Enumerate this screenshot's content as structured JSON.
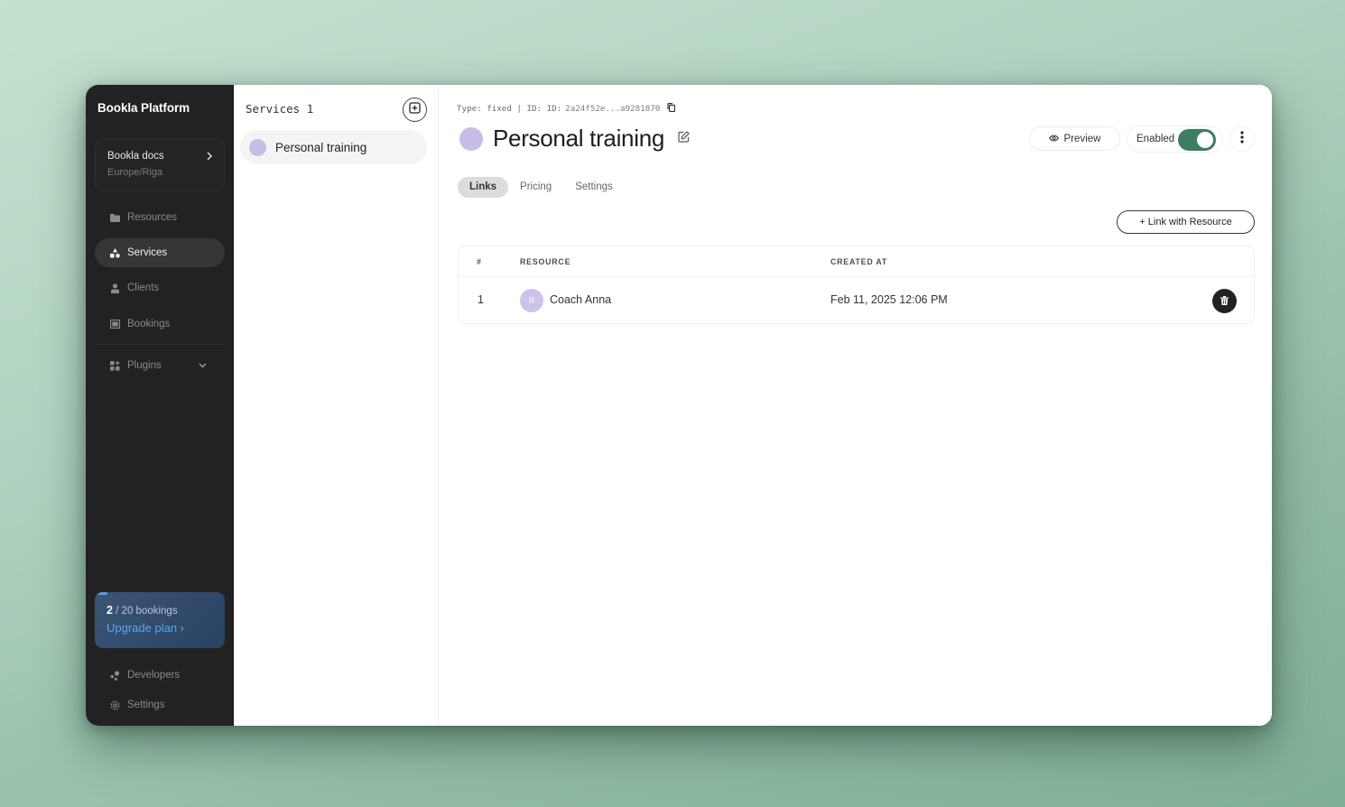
{
  "app": {
    "brand": "Bookla Platform"
  },
  "sidebar": {
    "org": {
      "name": "Bookla docs",
      "timezone": "Europe/Riga",
      "chevron": "chevron-right-icon"
    },
    "items": [
      {
        "label": "Resources",
        "icon": "folder-icon",
        "active": false
      },
      {
        "label": "Services",
        "icon": "shapes-icon",
        "active": true
      },
      {
        "label": "Clients",
        "icon": "user-icon",
        "active": false
      },
      {
        "label": "Bookings",
        "icon": "calendar-icon",
        "active": false
      },
      {
        "label": "Plugins",
        "icon": "grid-icon",
        "active": false,
        "expandable": true
      }
    ],
    "plan": {
      "used": "2",
      "separator": " / ",
      "total_label": "20 bookings",
      "progress": 0.1,
      "upgrade_label": "Upgrade plan ›"
    },
    "bottom_items": [
      {
        "label": "Developers",
        "icon": "developers-icon"
      },
      {
        "label": "Settings",
        "icon": "gear-icon"
      }
    ]
  },
  "services_pane": {
    "title": "Services 1",
    "add_icon": "add-square-icon",
    "items": [
      {
        "label": "Personal training",
        "color": "#c9bce6",
        "selected": true
      }
    ]
  },
  "detail": {
    "meta_prefix": "Type: fixed | ID: ID:",
    "id_value": "2a24f52e...a9281870",
    "title": "Personal training",
    "color": "#c9bce6",
    "preview_label": "Preview",
    "enabled_label": "Enabled",
    "enabled": true,
    "accent": "#3d7d63",
    "tabs": [
      {
        "label": "Links",
        "active": true
      },
      {
        "label": "Pricing",
        "active": false
      },
      {
        "label": "Settings",
        "active": false
      }
    ],
    "link_button_label": "+ Link with Resource",
    "table": {
      "columns": [
        "#",
        "RESOURCE",
        "CREATED AT"
      ],
      "rows": [
        {
          "index": "1",
          "avatar_initial": "R",
          "resource": "Coach Anna",
          "created_at": "Feb 11, 2025 12:06 PM"
        }
      ]
    }
  }
}
